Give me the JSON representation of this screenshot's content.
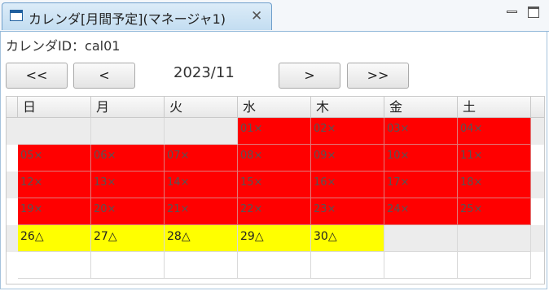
{
  "window": {
    "tab_title": "カレンダ[月間予定](マネージャ1)",
    "tab_close": "✕"
  },
  "calendar": {
    "id_label": "カレンダID：cal01",
    "month": "2023/11",
    "nav": {
      "prev_year": "<<",
      "prev_month": "<",
      "next_month": ">",
      "next_year": ">>"
    },
    "weekdays": [
      "日",
      "月",
      "火",
      "水",
      "木",
      "金",
      "土"
    ],
    "weeks": [
      [
        {
          "label": "",
          "status": "empty"
        },
        {
          "label": "",
          "status": "empty"
        },
        {
          "label": "",
          "status": "empty"
        },
        {
          "label": "01×",
          "status": "red"
        },
        {
          "label": "02×",
          "status": "red"
        },
        {
          "label": "03×",
          "status": "red"
        },
        {
          "label": "04×",
          "status": "red"
        }
      ],
      [
        {
          "label": "05×",
          "status": "red"
        },
        {
          "label": "06×",
          "status": "red"
        },
        {
          "label": "07×",
          "status": "red"
        },
        {
          "label": "08×",
          "status": "red"
        },
        {
          "label": "09×",
          "status": "red"
        },
        {
          "label": "10×",
          "status": "red"
        },
        {
          "label": "11×",
          "status": "red"
        }
      ],
      [
        {
          "label": "12×",
          "status": "red"
        },
        {
          "label": "13×",
          "status": "red"
        },
        {
          "label": "14×",
          "status": "red"
        },
        {
          "label": "15×",
          "status": "red"
        },
        {
          "label": "16×",
          "status": "red"
        },
        {
          "label": "17×",
          "status": "red"
        },
        {
          "label": "18×",
          "status": "red"
        }
      ],
      [
        {
          "label": "19×",
          "status": "red"
        },
        {
          "label": "20×",
          "status": "red"
        },
        {
          "label": "21×",
          "status": "red"
        },
        {
          "label": "22×",
          "status": "red"
        },
        {
          "label": "23×",
          "status": "red"
        },
        {
          "label": "24×",
          "status": "red"
        },
        {
          "label": "25×",
          "status": "red"
        }
      ],
      [
        {
          "label": "26△",
          "status": "yellow"
        },
        {
          "label": "27△",
          "status": "yellow"
        },
        {
          "label": "28△",
          "status": "yellow"
        },
        {
          "label": "29△",
          "status": "yellow"
        },
        {
          "label": "30△",
          "status": "yellow"
        },
        {
          "label": "",
          "status": "empty"
        },
        {
          "label": "",
          "status": "empty"
        }
      ],
      [
        {
          "label": "",
          "status": "empty"
        },
        {
          "label": "",
          "status": "empty"
        },
        {
          "label": "",
          "status": "empty"
        },
        {
          "label": "",
          "status": "empty"
        },
        {
          "label": "",
          "status": "empty"
        },
        {
          "label": "",
          "status": "empty"
        },
        {
          "label": "",
          "status": "empty"
        }
      ]
    ],
    "status_colors": {
      "red": "#ff0000",
      "yellow": "#ffff00"
    }
  }
}
